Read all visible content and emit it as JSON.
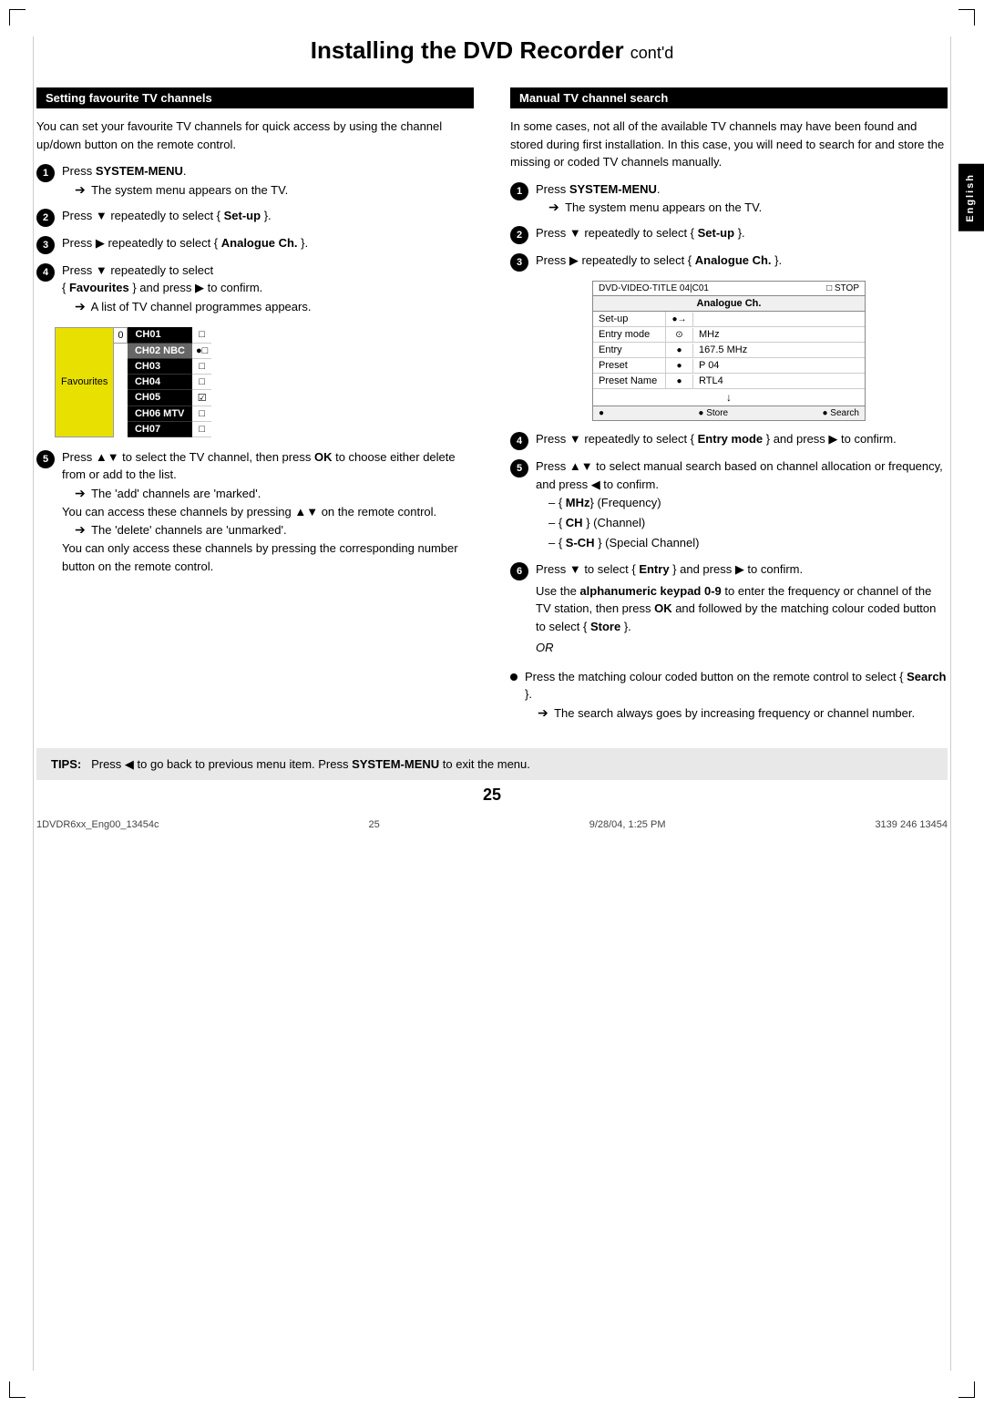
{
  "page": {
    "title": "Installing the DVD Recorder",
    "title_contd": "cont'd",
    "page_number": "25",
    "footer_left": "1DVDR6xx_Eng00_13454c",
    "footer_center": "25",
    "footer_right": "9/28/04, 1:25 PM",
    "footer_far_right": "3139 246 13454"
  },
  "english_tab": "English",
  "left_section": {
    "header": "Setting favourite TV channels",
    "intro": "You can set your favourite TV channels for quick access by using the channel up/down button on the remote control.",
    "steps": [
      {
        "num": "1",
        "text": "Press SYSTEM-MENU.",
        "bold_parts": [
          "SYSTEM-MENU"
        ],
        "arrow": "The system menu appears on the TV."
      },
      {
        "num": "2",
        "text": "Press ▼ repeatedly to select { Set-up }.",
        "bold_parts": [
          "Set-up"
        ]
      },
      {
        "num": "3",
        "text": "Press ▶ repeatedly to select { Analogue Ch. }.",
        "bold_parts": [
          "Analogue Ch."
        ]
      },
      {
        "num": "4",
        "text": "Press ▼ repeatedly to select { Favourites } and press ▶ to confirm.",
        "bold_parts": [
          "Favourites"
        ],
        "arrow": "A list of TV channel programmes appears."
      },
      {
        "num": "5",
        "text": "Press ▲▼ to select the TV channel, then press OK to choose either delete from or add to the list.",
        "bold_parts": [
          "OK"
        ],
        "arrows": [
          "The 'add' channels are 'marked'.",
          "You can access these channels by pressing ▲▼ on the remote control.",
          "The 'delete' channels are 'unmarked'.",
          "You can only access these channels by pressing the corresponding number button on the remote control."
        ]
      }
    ],
    "channel_table": {
      "label": "Favourites",
      "zero": "0",
      "channels": [
        {
          "code": "CH01",
          "icon": "□",
          "highlight": false
        },
        {
          "code": "CH02 NBC",
          "icon": "●□",
          "highlight": true
        },
        {
          "code": "CH03",
          "icon": "□",
          "highlight": false
        },
        {
          "code": "CH04",
          "icon": "□",
          "highlight": false
        },
        {
          "code": "CH05",
          "icon": "☑",
          "highlight": false
        },
        {
          "code": "CH06 MTV",
          "icon": "□",
          "highlight": false
        },
        {
          "code": "CH07",
          "icon": "□",
          "highlight": false
        }
      ]
    }
  },
  "right_section": {
    "header": "Manual TV channel search",
    "intro": "In some cases, not all of the available TV channels may have been found and stored during first installation. In this case, you will need to search for and store the missing or coded TV channels manually.",
    "steps": [
      {
        "num": "1",
        "text": "Press SYSTEM-MENU.",
        "bold_parts": [
          "SYSTEM-MENU"
        ],
        "arrow": "The system menu appears on the TV."
      },
      {
        "num": "2",
        "text": "Press ▼ repeatedly to select { Set-up }.",
        "bold_parts": [
          "Set-up"
        ]
      },
      {
        "num": "3",
        "text": "Press ▶ repeatedly to select { Analogue Ch. }.",
        "bold_parts": [
          "Analogue Ch."
        ]
      },
      {
        "num": "4",
        "text": "Press ▼ repeatedly to select { Entry mode } and press ▶ to confirm.",
        "bold_parts": [
          "Entry mode"
        ]
      },
      {
        "num": "5",
        "text": "Press ▲▼ to select manual search based on channel allocation or frequency, and press ◀ to confirm.",
        "bold_parts": [],
        "sub_items": [
          "{ MHz} (Frequency)",
          "{ CH } (Channel)",
          "{ S-CH } (Special Channel)"
        ],
        "sub_bold": [
          "MHz",
          "CH",
          "S-CH"
        ]
      },
      {
        "num": "6",
        "text": "Press ▼ to select { Entry } and press ▶ to confirm.",
        "bold_parts": [
          "Entry"
        ],
        "extra": "Use the alphanumeric keypad 0-9 to enter the frequency or channel of the TV station, then press OK and followed by the matching colour coded button to select { Store }.",
        "extra_bold": [
          "alphanumeric keypad 0-9",
          "OK",
          "Store"
        ],
        "or": "OR"
      }
    ],
    "bullet_step": {
      "text": "Press the matching colour coded button on the remote control to select { Search }.",
      "bold_parts": [
        "Search"
      ],
      "arrow": "The search always goes by increasing frequency or channel number."
    },
    "osd": {
      "top_left": "DVD-VIDEO-TITLE 04|C01",
      "top_right": "□ STOP",
      "title": "Analogue Ch.",
      "rows": [
        {
          "label": "Set-up",
          "ctrl": "●→",
          "value": ""
        },
        {
          "label": "Entry mode",
          "ctrl": "⊙",
          "value": "MHz"
        },
        {
          "label": "Entry",
          "ctrl": "●",
          "value": "167.5 MHz"
        },
        {
          "label": "Preset",
          "ctrl": "●",
          "value": "P 04"
        },
        {
          "label": "Preset Name",
          "ctrl": "●",
          "value": "RTL4"
        }
      ],
      "bottom_left": "●",
      "bottom_store": "● Store",
      "bottom_search": "● Search",
      "arrow_down": "↓"
    }
  },
  "tips": {
    "label": "TIPS:",
    "text": "Press ◀ to go back to previous menu item. Press SYSTEM-MENU to exit the menu.",
    "bold_parts": [
      "SYSTEM-MENU"
    ]
  }
}
